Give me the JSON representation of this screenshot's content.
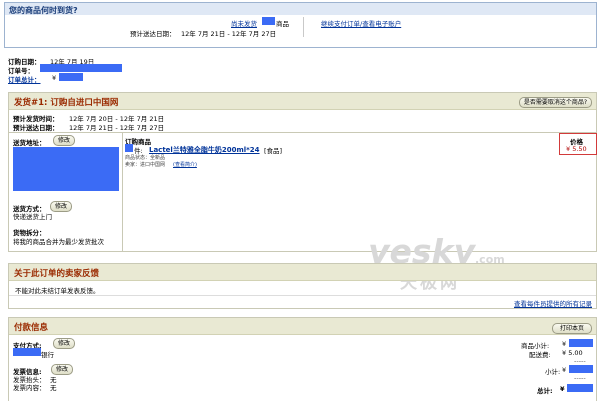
{
  "delivery_box": {
    "title": "您的商品何时到货?",
    "not_shipped": "尚未发货",
    "goods_suffix": "商品",
    "eta_label": "预计送达日期：",
    "eta_value": "12年 7月 21日 - 12年 7月 27日",
    "continue_link": "继续支付订单/查看电子账户"
  },
  "order_meta": {
    "order_date_label": "订购日期：",
    "order_date_value": "12年 7月 19日",
    "order_no_label": "订单号：",
    "order_total_label": "订单总计：",
    "order_total_currency": "¥"
  },
  "shipment": {
    "title": "发货#1: 订购自进口中国网",
    "cancel_button": "是否需要取消这个商品?",
    "ship_time_label": "预计发货时间：",
    "ship_time_value": "12年 7月 20日 - 12年 7月 21日",
    "delivery_time_label": "预计送达日期：",
    "delivery_time_value": "12年 7月 21日 - 12年 7月 27日",
    "address_label": "送货地址：",
    "modify": "修改",
    "method_label": "送货方式：",
    "method_value": "快递送货上门",
    "split_label": "货物拆分：",
    "split_value": "将我的商品合并为最少发货批次",
    "items_header": "订购商品",
    "item_qty_symbol": "件:",
    "item_name": "Lactel兰特雅全脂牛奶200ml*24",
    "item_category": "[食品]",
    "item_status": "商品状态：全新品",
    "item_seller": "卖家：进口中国网",
    "item_seller_link": "(查看简介)",
    "price_header": "价格",
    "price_value": "¥ 5.50"
  },
  "feedback": {
    "title": "关于此订单的卖家反馈",
    "text": "不能对此未结订单发表反馈。",
    "link": "查看每件员提供的所有记录"
  },
  "payment": {
    "title": "付款信息",
    "print_button": "打印本页",
    "method_label": "支付方式:",
    "modify": "修改",
    "bank_suffix": "银行",
    "invoice_label": "发票信息:",
    "invoice_title_label": "发票抬头：",
    "invoice_title_value": "无",
    "invoice_content_label": "发票内容：",
    "invoice_content_value": "无",
    "subtotal_label": "商品小计:",
    "currency": "¥",
    "shipping_label": "配送费:",
    "shipping_value": "¥ 5.00",
    "dashes": "-----",
    "sum_label": "小计:",
    "total_label": "总计:"
  },
  "watermark": {
    "main": "yesky",
    "domain": ".com",
    "cn": "天极网"
  },
  "colors": {
    "redact": "#3b6bf5",
    "header_bg": "#e9e9d3",
    "title_red": "#9a2a00",
    "link_blue": "#003399"
  }
}
